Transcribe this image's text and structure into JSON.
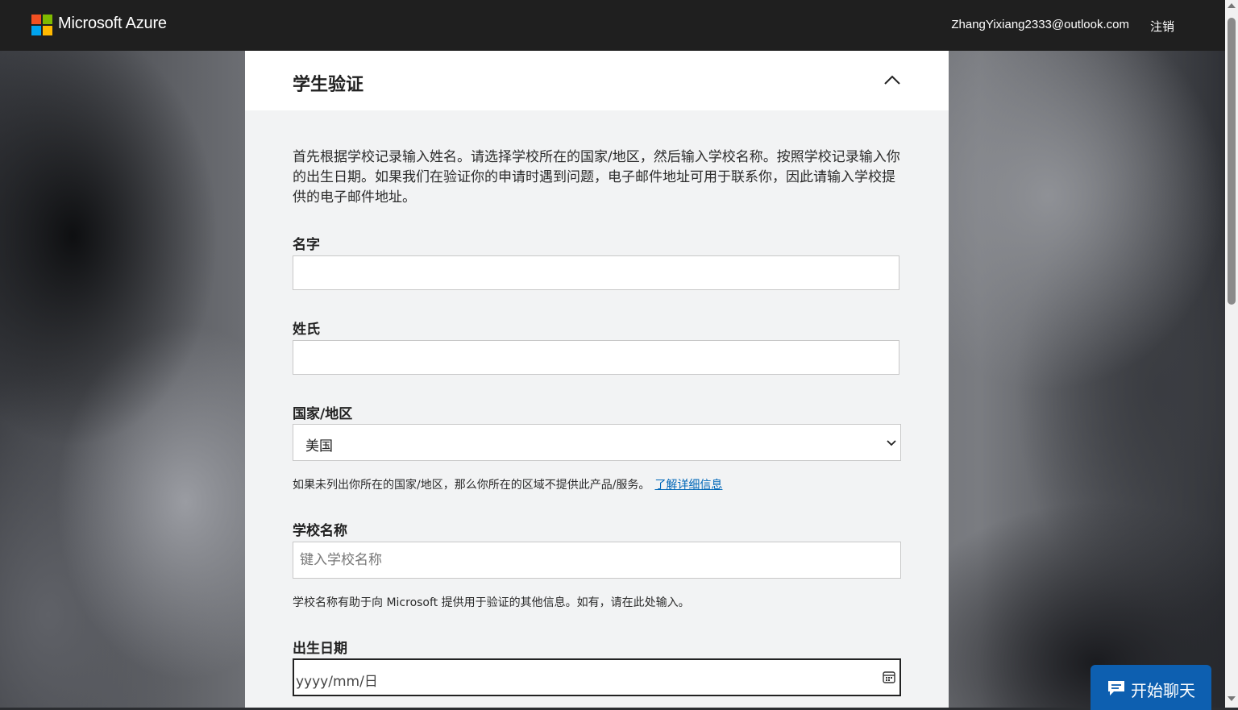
{
  "header": {
    "brand": "Microsoft Azure",
    "email": "ZhangYixiang2333@outlook.com",
    "signout_label": "注销",
    "logo_colors": [
      "#f25022",
      "#7fba00",
      "#00a4ef",
      "#ffb900"
    ]
  },
  "section": {
    "title": "学生验证",
    "intro": "首先根据学校记录输入姓名。请选择学校所在的国家/地区，然后输入学校名称。按照学校记录输入你的出生日期。如果我们在验证你的申请时遇到问题，电子邮件地址可用于联系你，因此请输入学校提供的电子邮件地址。"
  },
  "form": {
    "first_name": {
      "label": "名字",
      "value": ""
    },
    "last_name": {
      "label": "姓氏",
      "value": ""
    },
    "country": {
      "label": "国家/地区",
      "selected": "美国",
      "help": "如果未列出你所在的国家/地区，那么你所在的区域不提供此产品/服务。",
      "learn_more": "了解详细信息"
    },
    "school": {
      "label": "学校名称",
      "placeholder": "键入学校名称",
      "help": "学校名称有助于向 Microsoft 提供用于验证的其他信息。如有，请在此处输入。"
    },
    "birthdate": {
      "label": "出生日期",
      "placeholder": "yyyy/mm/日"
    }
  },
  "chat": {
    "label": "开始聊天"
  },
  "colors": {
    "accent": "#0067b8",
    "chat": "#0d5fb0",
    "topbar": "#1f1f1f",
    "panel": "#f2f3f4"
  }
}
